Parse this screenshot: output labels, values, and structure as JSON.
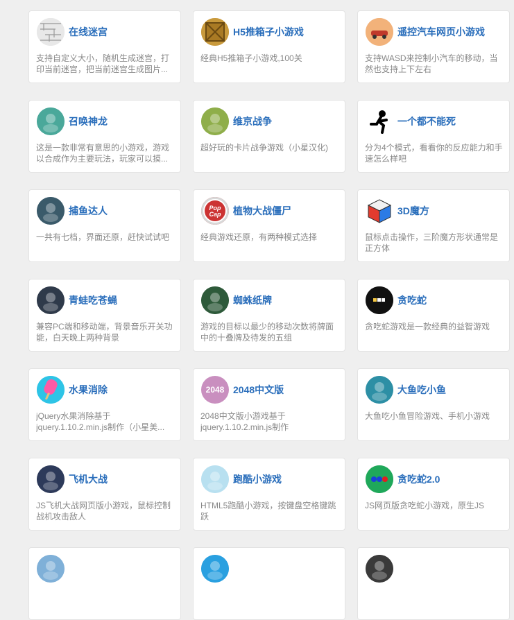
{
  "games": [
    {
      "title": "在线迷宫",
      "desc": "支持自定义大小，随机生成迷宫，打印当前迷宫，把当前迷宫生成图片...",
      "icon": "maze-icon",
      "color": "#dcdcdc"
    },
    {
      "title": "H5推箱子小游戏",
      "desc": "经典H5推箱子小游戏,100关",
      "icon": "crate-icon",
      "color": "#c99a3c"
    },
    {
      "title": "遥控汽车网页小游戏",
      "desc": "支持WASD来控制小汽车的移动，当然也支持上下左右",
      "icon": "car-icon",
      "color": "#f0a060"
    },
    {
      "title": "召唤神龙",
      "desc": "这是一款非常有意思的小游戏，游戏以合成作为主要玩法，玩家可以摸...",
      "icon": "dragon-icon",
      "color": "#4aa89a"
    },
    {
      "title": "维京战争",
      "desc": "超好玩的卡片战争游戏（小星汉化)",
      "icon": "viking-icon",
      "color": "#8fae4a"
    },
    {
      "title": "一个都不能死",
      "desc": "分为4个模式，看看你的反应能力和手速怎么样吧",
      "icon": "running-man-icon",
      "color": "#ffffff"
    },
    {
      "title": "捕鱼达人",
      "desc": "一共有七档，界面还原，赶快试试吧",
      "icon": "fish-icon",
      "color": "#3a5a6a"
    },
    {
      "title": "植物大战僵尸",
      "desc": "经典游戏还原，有两种模式选择",
      "icon": "popcap-icon",
      "color": "#c33"
    },
    {
      "title": "3D魔方",
      "desc": "鼠标点击操作，三阶魔方形状通常是正方体",
      "icon": "rubiks-cube-icon",
      "color": "#ffffff"
    },
    {
      "title": "青蛙吃苍蝇",
      "desc": "兼容PC端和移动端，背景音乐开关功能，白天晚上两种背景",
      "icon": "frog-icon",
      "color": "#2f3a4a"
    },
    {
      "title": "蜘蛛纸牌",
      "desc": "游戏的目标以最少的移动次数将牌面中的十叠牌及待发的五组",
      "icon": "cards-icon",
      "color": "#2e5a3a"
    },
    {
      "title": "贪吃蛇",
      "desc": "贪吃蛇游戏是一款经典的益智游戏",
      "icon": "snake-icon",
      "color": "#111111"
    },
    {
      "title": "水果消除",
      "desc": "jQuery水果消除基于jquery.1.10.2.min.js制作（小星美...",
      "icon": "popsicle-icon",
      "color": "#2ec4e6"
    },
    {
      "title": "2048中文版",
      "desc": "2048中文版小游戏基于jquery.1.10.2.min.js制作",
      "icon": "2048-icon",
      "color": "#c98fbf",
      "label": "2048"
    },
    {
      "title": "大鱼吃小鱼",
      "desc": "大鱼吃小鱼冒险游戏、手机小游戏",
      "icon": "shark-icon",
      "color": "#2d8fa5"
    },
    {
      "title": "飞机大战",
      "desc": "JS飞机大战网页版小游戏，鼠标控制战机攻击敌人",
      "icon": "plane-icon",
      "color": "#2d3a5a"
    },
    {
      "title": "跑酷小游戏",
      "desc": "HTML5跑酷小游戏，按键盘空格键跳跃",
      "icon": "runner-icon",
      "color": "#b8e0f0"
    },
    {
      "title": "贪吃蛇2.0",
      "desc": "JS网页版贪吃蛇小游戏，原生JS",
      "icon": "snake2-icon",
      "color": "#1fa85a"
    },
    {
      "title": "",
      "desc": "",
      "icon": "game-icon",
      "color": "#7fb0d8"
    },
    {
      "title": "",
      "desc": "",
      "icon": "game-icon",
      "color": "#2aa0e0"
    },
    {
      "title": "",
      "desc": "",
      "icon": "game-icon",
      "color": "#3a3a3a"
    }
  ]
}
